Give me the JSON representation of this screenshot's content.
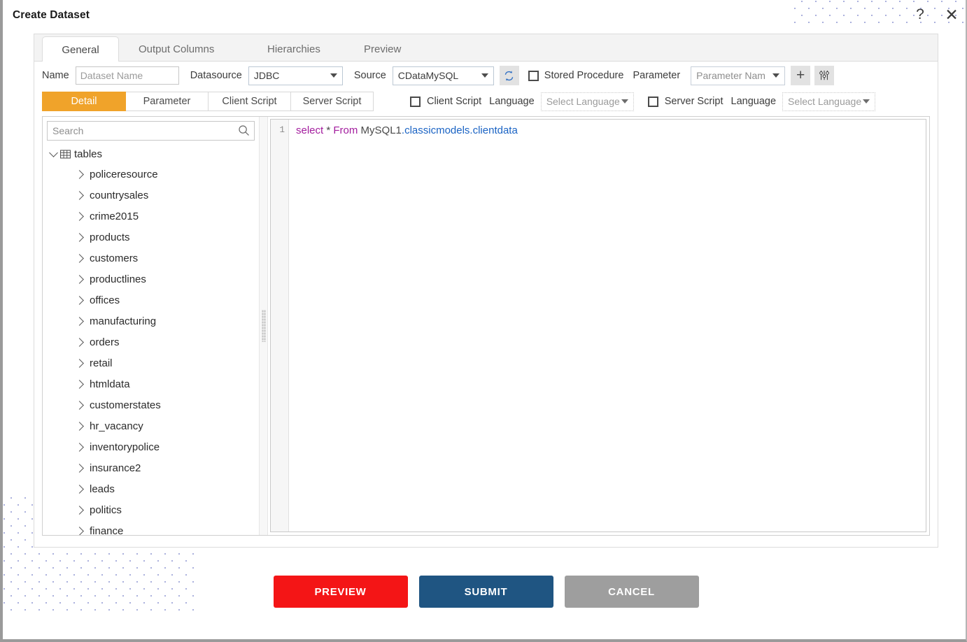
{
  "window": {
    "title": "Create Dataset",
    "help_icon": "question-mark-icon",
    "close_icon": "close-icon"
  },
  "tabs": [
    {
      "label": "General",
      "active": true
    },
    {
      "label": "Output Columns",
      "active": false
    },
    {
      "label": "Hierarchies",
      "active": false
    },
    {
      "label": "Preview",
      "active": false
    }
  ],
  "form": {
    "name_label": "Name",
    "name_placeholder": "Dataset Name",
    "name_value": "",
    "datasource_label": "Datasource",
    "datasource_value": "JDBC",
    "source_label": "Source",
    "source_value": "CDataMySQL",
    "refresh_icon": "refresh-icon",
    "stored_procedure_label": "Stored Procedure",
    "stored_procedure_checked": false,
    "parameter_label": "Parameter",
    "parameter_name_placeholder": "Parameter Nam",
    "parameter_name_value": "",
    "add_icon": "plus-icon",
    "settings_icon": "sliders-icon"
  },
  "subtabs": [
    {
      "label": "Detail",
      "active": true
    },
    {
      "label": "Parameter",
      "active": false
    },
    {
      "label": "Client Script",
      "active": false
    },
    {
      "label": "Server Script",
      "active": false
    }
  ],
  "scripts": {
    "client_script_label": "Client Script",
    "client_language_label": "Language",
    "client_checked": false,
    "client_language_placeholder": "Select Language",
    "server_script_label": "Server Script",
    "server_language_label": "Language",
    "server_checked": false,
    "server_language_placeholder": "Select Language"
  },
  "tree": {
    "search_placeholder": "Search",
    "search_value": "",
    "search_icon": "search-icon",
    "root_label": "tables",
    "root_icon": "table-grid-icon",
    "root_expanded": true,
    "nodes": [
      {
        "label": "policeresource"
      },
      {
        "label": "countrysales"
      },
      {
        "label": "crime2015"
      },
      {
        "label": "products"
      },
      {
        "label": "customers"
      },
      {
        "label": "productlines"
      },
      {
        "label": "offices"
      },
      {
        "label": "manufacturing"
      },
      {
        "label": "orders"
      },
      {
        "label": "retail"
      },
      {
        "label": "htmldata"
      },
      {
        "label": "customerstates"
      },
      {
        "label": "hr_vacancy"
      },
      {
        "label": "inventorypolice"
      },
      {
        "label": "insurance2"
      },
      {
        "label": "leads"
      },
      {
        "label": "politics"
      },
      {
        "label": "finance"
      }
    ]
  },
  "editor": {
    "line_number": "1",
    "tokens": {
      "select": "select",
      "star": "*",
      "from": "From",
      "schema": "MySQL1",
      "qualified": ".classicmodels.clientdata"
    },
    "full_text": "select * From MySQL1.classicmodels.clientdata"
  },
  "footer": {
    "preview_label": "PREVIEW",
    "submit_label": "SUBMIT",
    "cancel_label": "CANCEL"
  },
  "colors": {
    "accent_orange": "#f0a32a",
    "preview_red": "#f41516",
    "submit_blue": "#1f5582",
    "cancel_gray": "#9e9e9e",
    "sql_keyword": "#a31d9e",
    "sql_qualifier": "#1a63c4"
  }
}
